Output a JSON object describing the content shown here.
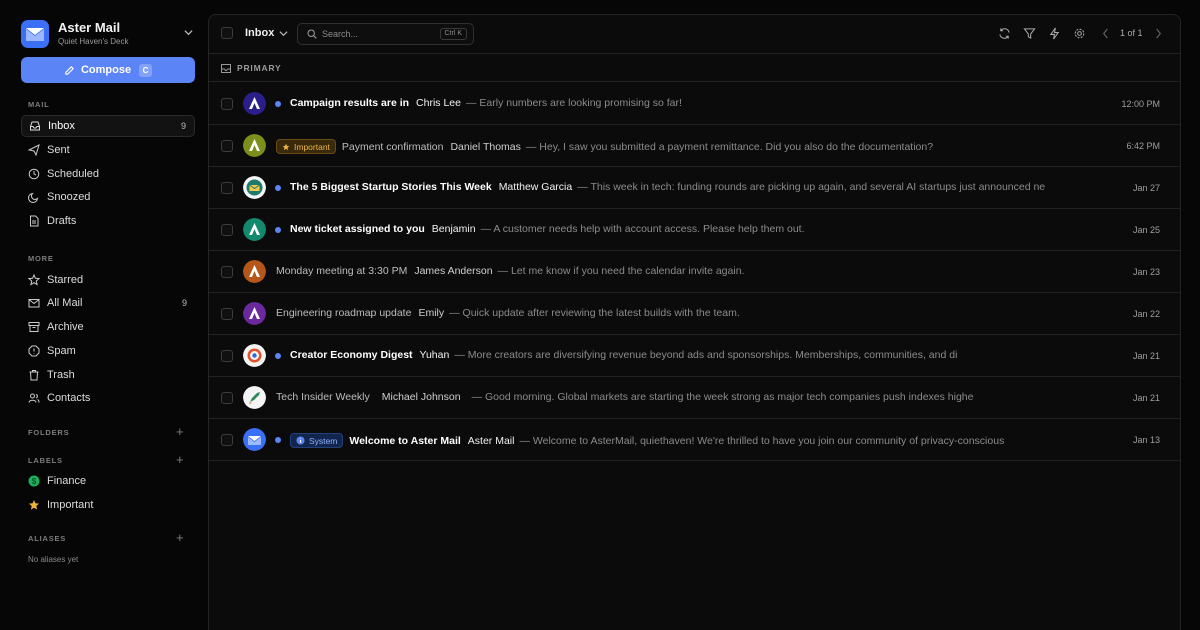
{
  "app": {
    "title": "Aster Mail",
    "subtitle": "Quiet Haven's Deck"
  },
  "colors": {
    "accent": "#5b84f6",
    "background": "#060606",
    "panel": "#0b0b0b",
    "important": "#f0b43c",
    "finance": "#1fae5b"
  },
  "compose": {
    "label": "Compose",
    "shortcut": "C"
  },
  "sections": {
    "mail": "MAIL",
    "more": "MORE",
    "folders": "FOLDERS",
    "labels": "LABELS",
    "aliases": "ALIASES"
  },
  "sidebar": {
    "mail": [
      {
        "label": "Inbox",
        "count": "9",
        "icon": "inbox-icon"
      },
      {
        "label": "Sent",
        "icon": "send-icon"
      },
      {
        "label": "Scheduled",
        "icon": "clock-icon"
      },
      {
        "label": "Snoozed",
        "icon": "snooze-icon"
      },
      {
        "label": "Drafts",
        "icon": "draft-icon"
      }
    ],
    "more": [
      {
        "label": "Starred",
        "icon": "star-icon"
      },
      {
        "label": "All Mail",
        "count": "9",
        "icon": "all-mail-icon"
      },
      {
        "label": "Archive",
        "icon": "archive-icon"
      },
      {
        "label": "Spam",
        "icon": "spam-icon"
      },
      {
        "label": "Trash",
        "icon": "trash-icon"
      },
      {
        "label": "Contacts",
        "icon": "contacts-icon"
      }
    ],
    "labels": [
      {
        "label": "Finance",
        "icon": "dollar-icon"
      },
      {
        "label": "Important",
        "icon": "star-icon"
      }
    ],
    "aliases_empty": "No aliases yet"
  },
  "toolbar": {
    "folder": "Inbox",
    "search_placeholder": "Search...",
    "search_shortcut": "Ctrl K",
    "pager": "1 of 1"
  },
  "primary_label": "PRIMARY",
  "emails": [
    {
      "subject": "Campaign results are in",
      "sender": "Chris Lee",
      "snippet": "— Early numbers are looking promising so far!",
      "date": "12:00 PM",
      "unread": true,
      "avatar": "aster-logo-blue"
    },
    {
      "badge": "Important",
      "subject": "Payment confirmation",
      "sender": "Daniel Thomas",
      "snippet": "— Hey, I saw you submitted a payment remittance. Did you also do the documentation?",
      "date": "6:42 PM",
      "unread": false,
      "avatar": "aster-logo-olive"
    },
    {
      "subject": "The 5 Biggest Startup Stories This Week",
      "sender": "Matthew Garcia",
      "snippet": "— This week in tech: funding rounds are picking up again, and several AI startups just announced new p",
      "date": "Jan 27",
      "unread": true,
      "avatar": "envelope-badge"
    },
    {
      "subject": "New ticket assigned to you",
      "sender": "Benjamin",
      "snippet": "— A customer needs help with account access. Please help them out.",
      "date": "Jan 25",
      "unread": true,
      "avatar": "aster-logo-teal"
    },
    {
      "subject": "Monday meeting at 3:30 PM",
      "sender": "James Anderson",
      "snippet": "— Let me know if you need the calendar invite again.",
      "date": "Jan 23",
      "unread": false,
      "avatar": "aster-logo-orange"
    },
    {
      "subject": "Engineering roadmap update",
      "sender": "Emily",
      "snippet": "— Quick update after reviewing the latest builds with the team.",
      "date": "Jan 22",
      "unread": false,
      "avatar": "aster-logo-purple"
    },
    {
      "subject": "Creator Economy Digest",
      "sender": "Yuhan",
      "snippet": "— More creators are diversifying revenue beyond ads and sponsorships. Memberships, communities, and di",
      "date": "Jan 21",
      "unread": true,
      "avatar": "target-badge"
    },
    {
      "subject": "Tech Insider Weekly",
      "sender": "Michael Johnson",
      "snippet": "— Good morning. Global markets are starting the week strong as major tech companies push indexes highe",
      "date": "Jan 21",
      "unread": false,
      "avatar": "rocket-badge"
    },
    {
      "badge": "System",
      "subject": "Welcome to Aster Mail",
      "sender": "Aster Mail",
      "snippet": "— Welcome to AsterMail, quiethaven! We're thrilled to have you join our community of privacy-conscious",
      "date": "Jan 13",
      "unread": true,
      "avatar": "aster-mail-logo"
    }
  ]
}
